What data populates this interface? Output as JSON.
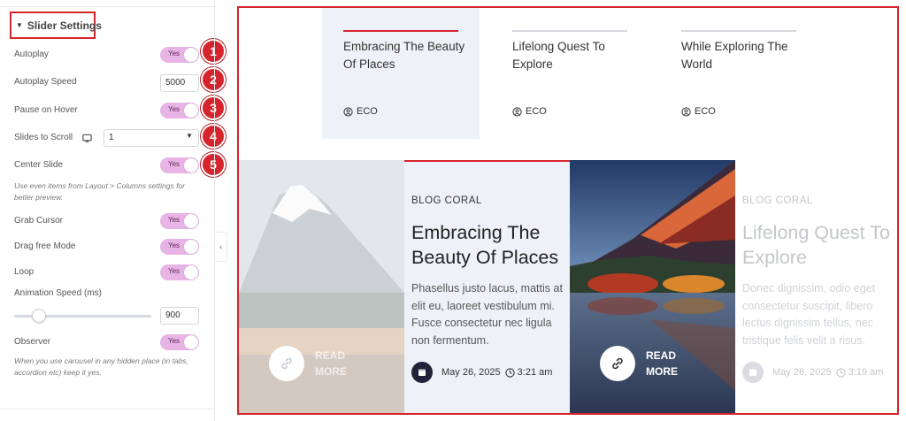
{
  "panel": {
    "section_title": "Slider Settings",
    "rows": {
      "autoplay": {
        "label": "Autoplay",
        "value": "Yes",
        "badge": "1"
      },
      "autoplay_speed": {
        "label": "Autoplay Speed",
        "value": "5000",
        "badge": "2"
      },
      "pause_on_hover": {
        "label": "Pause on Hover",
        "value": "Yes",
        "badge": "3"
      },
      "slides_to_scroll": {
        "label": "Slides to Scroll",
        "value": "1",
        "badge": "4"
      },
      "center_slide": {
        "label": "Center Slide",
        "value": "Yes",
        "badge": "5"
      },
      "center_hint": "Use even items from Layout > Columns settings for better preview.",
      "grab_cursor": {
        "label": "Grab Cursor",
        "value": "Yes"
      },
      "drag_free_mode": {
        "label": "Drag free Mode",
        "value": "Yes"
      },
      "loop": {
        "label": "Loop",
        "value": "Yes"
      },
      "animation_speed": {
        "label": "Animation Speed (ms)",
        "value": "900",
        "slider_fraction": 0.18
      },
      "observer": {
        "label": "Observer",
        "value": "Yes"
      },
      "observer_hint": "When you use carousel in any hidden place (in tabs, accordion etc) keep it yes."
    }
  },
  "preview": {
    "tabs": [
      {
        "title": "Embracing The Beauty Of Places",
        "category": "ECO",
        "active": true
      },
      {
        "title": "Lifelong Quest To Explore",
        "category": "ECO",
        "active": false
      },
      {
        "title": "While Exploring The World",
        "category": "ECO",
        "active": false
      }
    ],
    "card": {
      "category": "BLOG CORAL",
      "title": "Embracing The Beauty Of Places",
      "excerpt": "Phasellus justo lacus, mattis at elit eu, laoreet vestibulum mi. Fusce consectetur nec ligula non fermentum.",
      "date": "May 26, 2025",
      "time": "3:21 am"
    },
    "right_card": {
      "category": "BLOG CORAL",
      "title": "Lifelong Quest To Explore",
      "excerpt": "Donec dignissim, odio eget consectetur suscipit, libero lectus dignissim tellus, nec tristique felis velit a risus.",
      "date": "May 26, 2025",
      "time": "3:19 am"
    },
    "read_more_1": "READ MORE",
    "read_more_2": "READ MORE"
  },
  "colors": {
    "accent": "#d6242c",
    "toggle_on": "#e8b3e5",
    "card_bg": "#eef2f8"
  }
}
